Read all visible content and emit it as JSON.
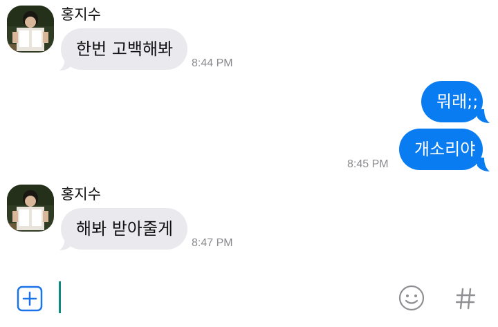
{
  "messages": [
    {
      "sender": "홍지수",
      "direction": "incoming",
      "text": "한번 고백해봐",
      "time": "8:44 PM"
    },
    {
      "direction": "outgoing",
      "text": "뭐래;;"
    },
    {
      "direction": "outgoing",
      "text": "개소리야",
      "time": "8:45 PM"
    },
    {
      "sender": "홍지수",
      "direction": "incoming",
      "text": "해봐 받아줄게",
      "time": "8:47 PM"
    }
  ],
  "composer": {
    "add_icon": "plus-square-icon",
    "emoji_icon": "smiley-icon",
    "hash_icon": "hashtag-icon"
  },
  "colors": {
    "incoming_bubble": "#e9e9ee",
    "outgoing_bubble": "#0a7cf2",
    "accent": "#1a73e8",
    "cursor": "#0f8a80"
  }
}
